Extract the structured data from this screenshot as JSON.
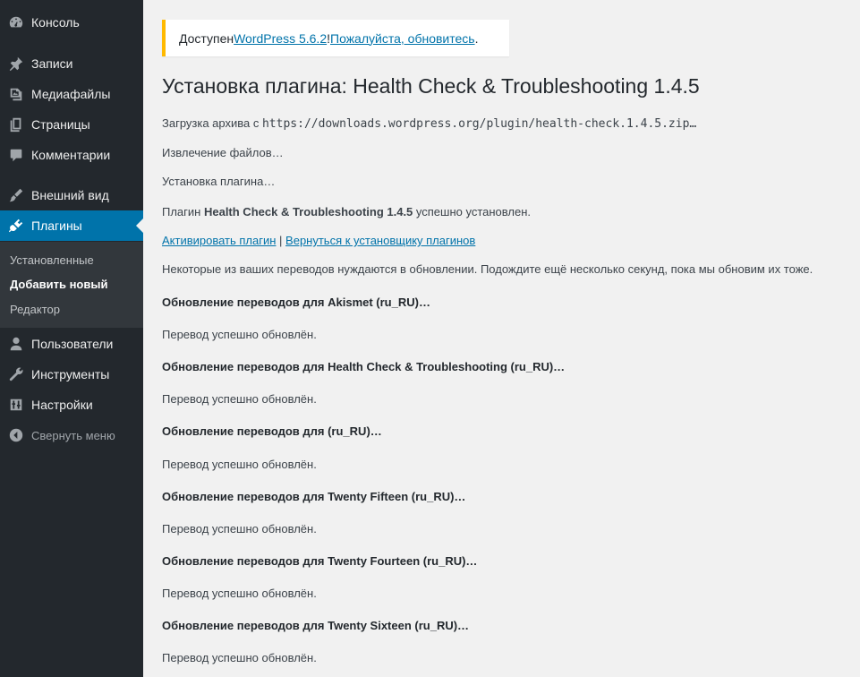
{
  "sidebar": {
    "items": [
      {
        "label": "Консоль",
        "icon": "dashboard-icon"
      },
      {
        "label": "Записи",
        "icon": "pin-icon"
      },
      {
        "label": "Медиафайлы",
        "icon": "media-icon"
      },
      {
        "label": "Страницы",
        "icon": "pages-icon"
      },
      {
        "label": "Комментарии",
        "icon": "comment-icon"
      },
      {
        "label": "Внешний вид",
        "icon": "brush-icon"
      },
      {
        "label": "Плагины",
        "icon": "plugin-icon"
      },
      {
        "label": "Пользователи",
        "icon": "user-icon"
      },
      {
        "label": "Инструменты",
        "icon": "wrench-icon"
      },
      {
        "label": "Настройки",
        "icon": "settings-icon"
      }
    ],
    "submenu": [
      {
        "label": "Установленные"
      },
      {
        "label": "Добавить новый"
      },
      {
        "label": "Редактор"
      }
    ],
    "collapse_label": "Свернуть меню",
    "active_color": "#0073aa",
    "background_color": "#23282d"
  },
  "notice": {
    "prefix": "Доступен ",
    "version_link": "WordPress 5.6.2",
    "separator": "! ",
    "update_link": "Пожалуйста, обновитесь",
    "suffix": ".",
    "accent_color": "#ffb900"
  },
  "page": {
    "title": "Установка плагина: Health Check & Troubleshooting 1.4.5",
    "download_prefix": "Загрузка архива с ",
    "download_url": "https://downloads.wordpress.org/plugin/health-check.1.4.5.zip…",
    "extracting": "Извлечение файлов…",
    "installing": "Установка плагина…",
    "installed_prefix": "Плагин ",
    "installed_name": "Health Check & Troubleshooting 1.4.5",
    "installed_suffix": " успешно установлен.",
    "activate_link": "Активировать плагин",
    "links_separator": " | ",
    "return_link": "Вернуться к установщику плагинов",
    "translations_notice": "Некоторые из ваших переводов нуждаются в обновлении. Подождите ещё несколько секунд, пока мы обновим их тоже.",
    "updates": [
      {
        "heading": "Обновление переводов для Akismet (ru_RU)…",
        "result": "Перевод успешно обновлён."
      },
      {
        "heading": "Обновление переводов для Health Check & Troubleshooting (ru_RU)…",
        "result": "Перевод успешно обновлён."
      },
      {
        "heading": "Обновление переводов для (ru_RU)…",
        "result": "Перевод успешно обновлён."
      },
      {
        "heading": "Обновление переводов для Twenty Fifteen (ru_RU)…",
        "result": "Перевод успешно обновлён."
      },
      {
        "heading": "Обновление переводов для Twenty Fourteen (ru_RU)…",
        "result": "Перевод успешно обновлён."
      },
      {
        "heading": "Обновление переводов для Twenty Sixteen (ru_RU)…",
        "result": "Перевод успешно обновлён."
      }
    ]
  }
}
